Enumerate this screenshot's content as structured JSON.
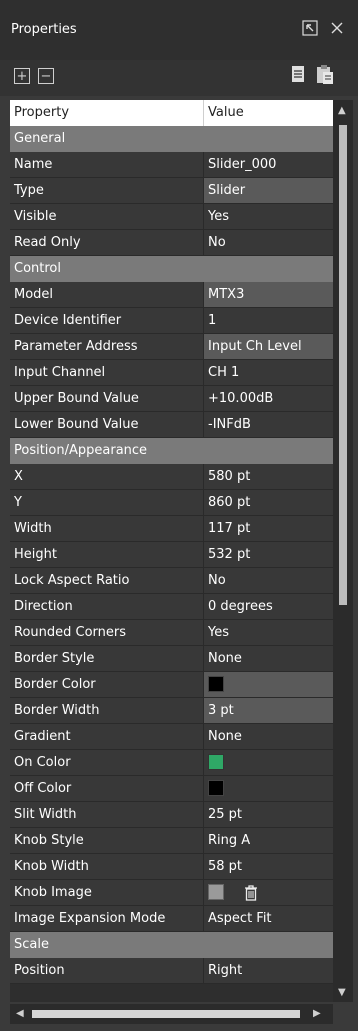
{
  "panel": {
    "title": "Properties"
  },
  "toolbar": {
    "expand_label": "+",
    "collapse_label": "−"
  },
  "grid": {
    "header": {
      "property": "Property",
      "value": "Value"
    },
    "rows": [
      {
        "type": "category",
        "label": "General"
      },
      {
        "type": "prop",
        "label": "Name",
        "value": "Slider_000"
      },
      {
        "type": "prop",
        "label": "Type",
        "value": "Slider",
        "alt": true
      },
      {
        "type": "prop",
        "label": "Visible",
        "value": "Yes"
      },
      {
        "type": "prop",
        "label": "Read Only",
        "value": "No"
      },
      {
        "type": "category",
        "label": "Control"
      },
      {
        "type": "prop",
        "label": "Model",
        "value": "MTX3",
        "alt": true
      },
      {
        "type": "prop",
        "label": "Device Identifier",
        "value": "1"
      },
      {
        "type": "prop",
        "label": "Parameter Address",
        "value": "Input Ch Level",
        "alt": true
      },
      {
        "type": "prop",
        "label": "Input Channel",
        "value": "CH 1"
      },
      {
        "type": "prop",
        "label": "Upper Bound Value",
        "value": "+10.00dB"
      },
      {
        "type": "prop",
        "label": "Lower Bound Value",
        "value": "-INFdB"
      },
      {
        "type": "category",
        "label": "Position/Appearance"
      },
      {
        "type": "prop",
        "label": "X",
        "value": "580 pt"
      },
      {
        "type": "prop",
        "label": "Y",
        "value": "860 pt"
      },
      {
        "type": "prop",
        "label": "Width",
        "value": "117 pt"
      },
      {
        "type": "prop",
        "label": "Height",
        "value": "532 pt"
      },
      {
        "type": "prop",
        "label": "Lock Aspect Ratio",
        "value": "No"
      },
      {
        "type": "prop",
        "label": "Direction",
        "value": "0 degrees"
      },
      {
        "type": "prop",
        "label": "Rounded Corners",
        "value": "Yes"
      },
      {
        "type": "prop",
        "label": "Border Style",
        "value": "None"
      },
      {
        "type": "prop",
        "label": "Border Color",
        "value": "",
        "swatch": "black",
        "alt": true
      },
      {
        "type": "prop",
        "label": "Border Width",
        "value": "3 pt",
        "alt": true
      },
      {
        "type": "prop",
        "label": "Gradient",
        "value": "None"
      },
      {
        "type": "prop",
        "label": "On Color",
        "value": "",
        "swatch": "green"
      },
      {
        "type": "prop",
        "label": "Off Color",
        "value": "",
        "swatch": "black"
      },
      {
        "type": "prop",
        "label": "Slit Width",
        "value": "25 pt"
      },
      {
        "type": "prop",
        "label": "Knob Style",
        "value": "Ring A"
      },
      {
        "type": "prop",
        "label": "Knob Width",
        "value": "58 pt"
      },
      {
        "type": "prop",
        "label": "Knob Image",
        "value": "",
        "swatch": "gray",
        "trash": true
      },
      {
        "type": "prop",
        "label": "Image Expansion Mode",
        "value": "Aspect Fit"
      },
      {
        "type": "category",
        "label": "Scale"
      },
      {
        "type": "prop",
        "label": "Position",
        "value": "Right"
      }
    ]
  },
  "icons": {
    "popout": "popout-window-icon",
    "close": "close-icon",
    "expand": "expand-all-icon",
    "collapse": "collapse-all-icon",
    "copy": "copy-icon",
    "paste": "paste-icon",
    "trash": "trash-icon"
  }
}
